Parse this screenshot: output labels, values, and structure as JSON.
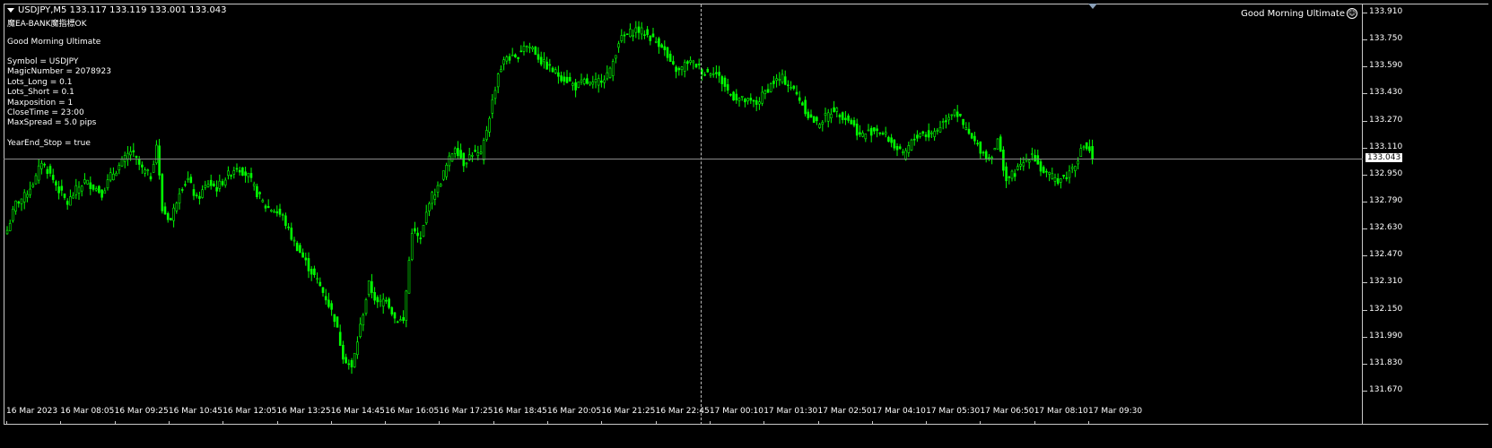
{
  "header": {
    "symbol_line": "USDJPY,M5  133.117 133.119 133.001 133.043",
    "status_line": "魔EA-BANK魔指標OK"
  },
  "ea_panel": {
    "name": "Good Morning Ultimate",
    "lines": [
      "Symbol = USDJPY",
      "MagicNumber = 2078923",
      "Lots_Long = 0.1",
      "Lots_Short = 0.1",
      "Maxposition = 1",
      "CloseTime = 23:00",
      "MaxSpread = 5.0 pips"
    ],
    "year_end": "YearEnd_Stop = true"
  },
  "ea_name_right": "Good Morning Ultimate",
  "smiley_icon": "smiley-face-icon",
  "colors": {
    "background": "#000000",
    "candle": "#00ff00",
    "bid_line": "#8a8a8a",
    "grid_frame": "#c8c8c8"
  },
  "price_axis": {
    "ticks": [
      "133.910",
      "133.750",
      "133.590",
      "133.430",
      "133.270",
      "133.110",
      "132.950",
      "132.790",
      "132.630",
      "132.470",
      "132.310",
      "132.150",
      "131.990",
      "131.830",
      "131.670"
    ],
    "current_price": "133.043"
  },
  "time_axis": {
    "labels": [
      "16 Mar 2023",
      "16 Mar 08:05",
      "16 Mar 09:25",
      "16 Mar 10:45",
      "16 Mar 12:05",
      "16 Mar 13:25",
      "16 Mar 14:45",
      "16 Mar 16:05",
      "16 Mar 17:25",
      "16 Mar 18:45",
      "16 Mar 20:05",
      "16 Mar 21:25",
      "16 Mar 22:45",
      "17 Mar 00:10",
      "17 Mar 01:30",
      "17 Mar 02:50",
      "17 Mar 04:10",
      "17 Mar 05:30",
      "17 Mar 06:50",
      "17 Mar 08:10",
      "17 Mar 09:30"
    ]
  },
  "chart_data": {
    "type": "candlestick",
    "symbol": "USDJPY",
    "timeframe": "M5",
    "ylim": [
      131.67,
      133.91
    ],
    "last": {
      "open": 133.117,
      "high": 133.119,
      "low": 133.001,
      "close": 133.043
    },
    "anchor_closes": [
      [
        0,
        132.62
      ],
      [
        3,
        132.78
      ],
      [
        6,
        132.82
      ],
      [
        10,
        132.93
      ],
      [
        12,
        133.03
      ],
      [
        15,
        132.95
      ],
      [
        18,
        132.86
      ],
      [
        21,
        132.78
      ],
      [
        24,
        132.86
      ],
      [
        27,
        132.91
      ],
      [
        30,
        132.88
      ],
      [
        33,
        132.84
      ],
      [
        36,
        132.94
      ],
      [
        40,
        133.02
      ],
      [
        43,
        133.09
      ],
      [
        47,
        132.98
      ],
      [
        50,
        132.94
      ],
      [
        52,
        133.13
      ],
      [
        54,
        132.74
      ],
      [
        57,
        132.68
      ],
      [
        60,
        132.86
      ],
      [
        63,
        132.92
      ],
      [
        66,
        132.8
      ],
      [
        70,
        132.9
      ],
      [
        73,
        132.87
      ],
      [
        76,
        132.93
      ],
      [
        80,
        133.0
      ],
      [
        84,
        132.94
      ],
      [
        87,
        132.84
      ],
      [
        90,
        132.76
      ],
      [
        93,
        132.74
      ],
      [
        96,
        132.7
      ],
      [
        99,
        132.58
      ],
      [
        102,
        132.49
      ],
      [
        105,
        132.4
      ],
      [
        108,
        132.32
      ],
      [
        111,
        132.22
      ],
      [
        114,
        132.1
      ],
      [
        117,
        131.88
      ],
      [
        120,
        131.8
      ],
      [
        123,
        132.05
      ],
      [
        126,
        132.3
      ],
      [
        129,
        132.18
      ],
      [
        132,
        132.22
      ],
      [
        135,
        132.1
      ],
      [
        138,
        132.08
      ],
      [
        141,
        132.62
      ],
      [
        144,
        132.56
      ],
      [
        147,
        132.8
      ],
      [
        150,
        132.87
      ],
      [
        153,
        133.0
      ],
      [
        156,
        133.12
      ],
      [
        159,
        133.02
      ],
      [
        162,
        133.08
      ],
      [
        165,
        133.06
      ],
      [
        168,
        133.3
      ],
      [
        171,
        133.55
      ],
      [
        174,
        133.65
      ],
      [
        177,
        133.63
      ],
      [
        180,
        133.72
      ],
      [
        183,
        133.7
      ],
      [
        186,
        133.62
      ],
      [
        189,
        133.58
      ],
      [
        192,
        133.54
      ],
      [
        195,
        133.51
      ],
      [
        198,
        133.47
      ],
      [
        201,
        133.5
      ],
      [
        204,
        133.48
      ],
      [
        207,
        133.52
      ],
      [
        210,
        133.56
      ],
      [
        213,
        133.74
      ],
      [
        216,
        133.78
      ],
      [
        219,
        133.81
      ],
      [
        222,
        133.79
      ],
      [
        225,
        133.75
      ],
      [
        228,
        133.72
      ],
      [
        231,
        133.6
      ],
      [
        234,
        133.56
      ],
      [
        237,
        133.62
      ],
      [
        240,
        133.6
      ],
      [
        243,
        133.55
      ],
      [
        246,
        133.57
      ],
      [
        249,
        133.5
      ],
      [
        252,
        133.42
      ],
      [
        255,
        133.4
      ],
      [
        258,
        133.38
      ],
      [
        261,
        133.37
      ],
      [
        264,
        133.44
      ],
      [
        267,
        133.5
      ],
      [
        270,
        133.52
      ],
      [
        273,
        133.47
      ],
      [
        276,
        133.4
      ],
      [
        279,
        133.3
      ],
      [
        282,
        133.25
      ],
      [
        285,
        133.29
      ],
      [
        288,
        133.34
      ],
      [
        291,
        133.3
      ],
      [
        294,
        133.26
      ],
      [
        297,
        133.18
      ],
      [
        300,
        133.2
      ],
      [
        303,
        133.22
      ],
      [
        306,
        133.18
      ],
      [
        309,
        133.12
      ],
      [
        312,
        133.06
      ],
      [
        315,
        133.14
      ],
      [
        318,
        133.2
      ],
      [
        321,
        133.18
      ],
      [
        324,
        133.22
      ],
      [
        327,
        133.28
      ],
      [
        330,
        133.34
      ],
      [
        333,
        133.24
      ],
      [
        336,
        133.16
      ],
      [
        339,
        133.1
      ],
      [
        342,
        133.04
      ],
      [
        345,
        133.15
      ],
      [
        348,
        132.92
      ],
      [
        351,
        132.96
      ],
      [
        354,
        133.02
      ],
      [
        357,
        133.08
      ],
      [
        360,
        132.98
      ],
      [
        363,
        132.94
      ],
      [
        366,
        132.92
      ],
      [
        369,
        132.94
      ],
      [
        372,
        133.02
      ],
      [
        375,
        133.12
      ],
      [
        378,
        133.08
      ]
    ]
  }
}
